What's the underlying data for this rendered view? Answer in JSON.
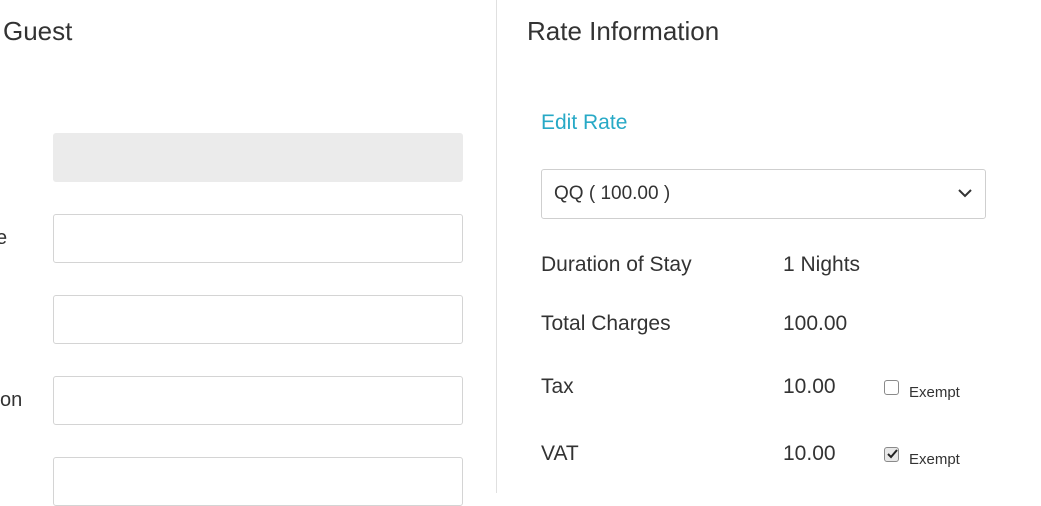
{
  "left_panel": {
    "title": "Guest",
    "labels": [
      "e",
      "on"
    ]
  },
  "right_panel": {
    "title": "Rate Information",
    "edit_rate_label": "Edit Rate",
    "rate_select": {
      "selected": "QQ ( 100.00 )",
      "icon": "chevron-down-icon"
    },
    "rows": {
      "duration": {
        "label": "Duration of Stay",
        "value": "1 Nights"
      },
      "total": {
        "label": "Total Charges",
        "value": "100.00"
      },
      "tax": {
        "label": "Tax",
        "value": "10.00",
        "exempt_label": "Exempt",
        "exempt_checked": false
      },
      "vat": {
        "label": "VAT",
        "value": "10.00",
        "exempt_label": "Exempt",
        "exempt_checked": true
      }
    }
  },
  "colors": {
    "link": "#27a9c6",
    "text": "#333333",
    "readonly_field": "#ebebeb",
    "border": "#d4d4d4"
  }
}
